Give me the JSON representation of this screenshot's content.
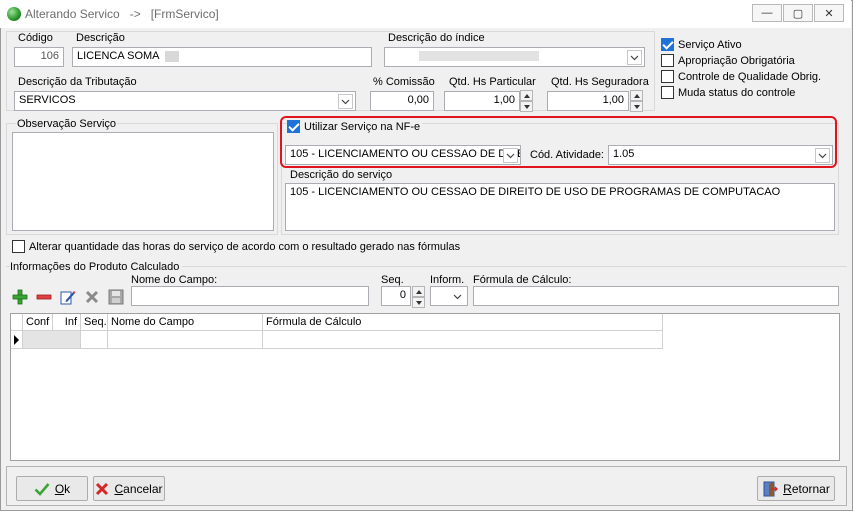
{
  "window": {
    "title": "Alterando Servico   ->   [FrmServico]",
    "minimize_glyph": "—",
    "maximize_glyph": "▢",
    "close_glyph": "✕"
  },
  "fields": {
    "codigo_label": "Código",
    "codigo_value": "106",
    "descricao_label": "Descrição",
    "descricao_value": "LICENCA SOMA",
    "descricao_indice_label": "Descrição do índice",
    "descricao_indice_value": "",
    "tributacao_label": "Descrição da Tributação",
    "tributacao_value": "SERVICOS",
    "comissao_label": "% Comissão",
    "comissao_value": "0,00",
    "hs_particular_label": "Qtd. Hs Particular",
    "hs_particular_value": "1,00",
    "hs_seguradora_label": "Qtd. Hs Seguradora",
    "hs_seguradora_value": "1,00"
  },
  "checkboxes": {
    "servico_ativo": {
      "label": "Serviço Ativo",
      "checked": true
    },
    "apropriacao": {
      "label": "Apropriação Obrigatória",
      "checked": false
    },
    "controle_qualidade": {
      "label": "Controle de Qualidade Obrig.",
      "checked": false
    },
    "muda_status": {
      "label": "Muda status do controle",
      "checked": false
    },
    "alterar_qtd": {
      "label": "Alterar quantidade das horas do serviço de acordo com o resultado gerado nas fórmulas",
      "checked": false
    }
  },
  "observacao": {
    "title": "Observação Serviço",
    "text": ""
  },
  "nfe": {
    "utilizar_label": "Utilizar Serviço na NF-e",
    "utilizar_checked": true,
    "servico_value": "105 - LICENCIAMENTO OU CESSAO DE DIRE",
    "cod_atividade_label": "Cód. Atividade:",
    "cod_atividade_value": "1.05",
    "descricao_servico_label": "Descrição do serviço",
    "descricao_servico_value": "105 - LICENCIAMENTO OU CESSAO DE DIREITO DE USO DE PROGRAMAS DE COMPUTACAO"
  },
  "calculado": {
    "title": "Informações do Produto Calculado",
    "nome_campo_label": "Nome do Campo:",
    "seq_label": "Seq.",
    "seq_value": "0",
    "inform_label": "Inform.",
    "formula_label": "Fórmula de Cálculo:",
    "grid_columns": [
      "Conf",
      "Inf",
      "Seq.",
      "Nome do Campo",
      "Fórmula de Cálculo"
    ]
  },
  "buttons": {
    "ok_first": "O",
    "ok_rest": "k",
    "cancelar_first": "C",
    "cancelar_rest": "ancelar",
    "retornar_first": "R",
    "retornar_rest": "etornar"
  },
  "colors": {
    "highlight": "#e0141e",
    "checkbox_checked": "#1f72d6",
    "window_bg": "#f0f0f0"
  }
}
